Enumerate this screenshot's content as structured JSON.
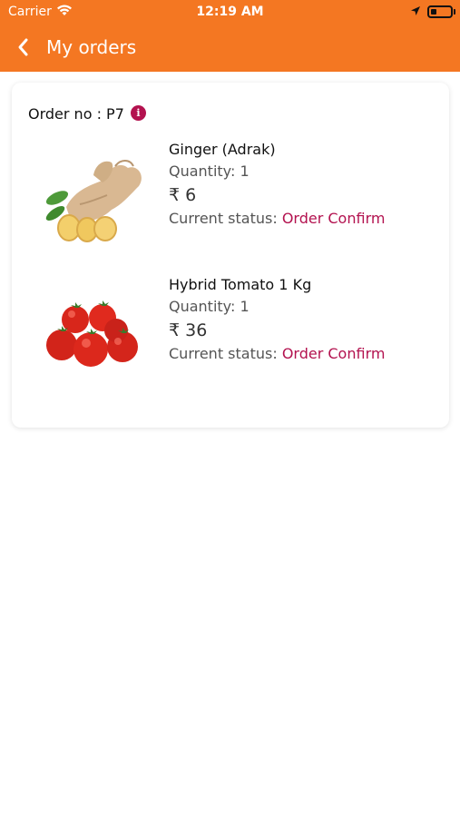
{
  "status_bar": {
    "carrier": "Carrier",
    "time": "12:19 AM"
  },
  "header": {
    "title": "My orders",
    "color": "#f47722"
  },
  "order": {
    "label": "Order no : P7",
    "items": [
      {
        "name": "Ginger (Adrak)",
        "quantity": "Quantity: 1",
        "price": "₹ 6",
        "status_label": "Current status:",
        "status_value": "Order Confirm",
        "image": "ginger"
      },
      {
        "name": "Hybrid Tomato 1 Kg",
        "quantity": "Quantity: 1",
        "price": "₹ 36",
        "status_label": "Current status:",
        "status_value": "Order Confirm",
        "image": "tomato"
      }
    ]
  },
  "accent_color": "#b3124f"
}
